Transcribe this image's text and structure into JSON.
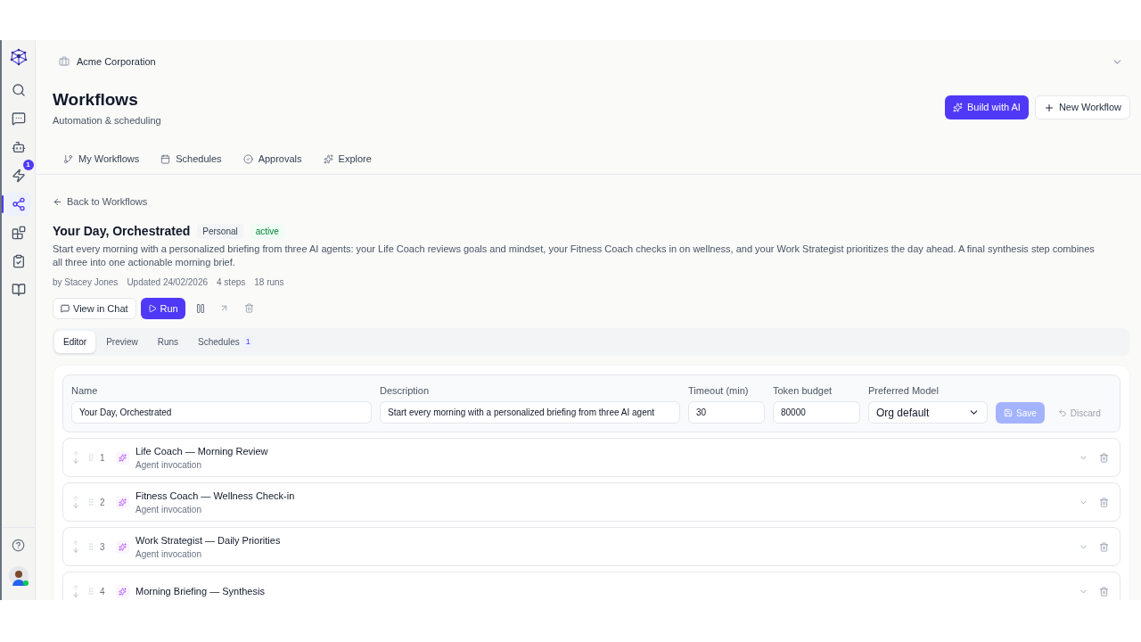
{
  "sidebar": {
    "items": [
      {
        "selected": false
      },
      {
        "selected": false
      },
      {
        "selected": false
      },
      {
        "selected": false,
        "badge": "1"
      },
      {
        "selected": true
      },
      {
        "selected": false
      },
      {
        "selected": false
      },
      {
        "selected": false
      }
    ]
  },
  "org": {
    "name": "Acme Corporation"
  },
  "header": {
    "title": "Workflows",
    "subtitle": "Automation & scheduling",
    "buttons": [
      {
        "label": "Build with AI",
        "kind": "primary"
      },
      {
        "label": "New Workflow",
        "kind": "secondary"
      }
    ]
  },
  "nav_tabs": [
    {
      "label": "My Workflows",
      "selected": false
    },
    {
      "label": "Schedules",
      "selected": false
    },
    {
      "label": "Approvals",
      "selected": false
    },
    {
      "label": "Explore",
      "selected": false
    }
  ],
  "back_link": "Back to Workflows",
  "workflow": {
    "title": "Your Day, Orchestrated",
    "tags": [
      {
        "label": "Personal",
        "kind": "scope"
      },
      {
        "label": "active",
        "kind": "status"
      }
    ],
    "description": "Start every morning with a personalized briefing from three AI agents: your Life Coach reviews goals and mindset, your Fitness Coach checks in on wellness, and your Work Strategist prioritizes the day ahead. A final synthesis step combines all three into one actionable morning brief.",
    "meta": [
      "by Stacey Jones",
      "Updated 24/02/2026",
      "4 steps",
      "18 runs"
    ],
    "actions": [
      {
        "label": "View in Chat",
        "kind": "secondary"
      },
      {
        "label": "Run",
        "kind": "primary"
      }
    ]
  },
  "editor_tabs": [
    {
      "label": "Editor",
      "selected": true
    },
    {
      "label": "Preview",
      "selected": false
    },
    {
      "label": "Runs",
      "selected": false
    },
    {
      "label": "Schedules",
      "selected": false,
      "count": "1"
    }
  ],
  "form": {
    "name": {
      "label": "Name",
      "value": "Your Day, Orchestrated"
    },
    "description": {
      "label": "Description",
      "value": "Start every morning with a personalized briefing from three AI agent"
    },
    "timeout": {
      "label": "Timeout (min)",
      "value": "30"
    },
    "token_budget": {
      "label": "Token budget",
      "value": "80000"
    },
    "model": {
      "label": "Preferred Model",
      "value": "Org default"
    },
    "save": {
      "label": "Save",
      "disabled": true
    },
    "discard": {
      "label": "Discard",
      "disabled": true
    }
  },
  "steps": [
    {
      "number": "1",
      "title": "Life Coach — Morning Review",
      "subtitle": "Agent invocation"
    },
    {
      "number": "2",
      "title": "Fitness Coach — Wellness Check-in",
      "subtitle": "Agent invocation"
    },
    {
      "number": "3",
      "title": "Work Strategist — Daily Priorities",
      "subtitle": "Agent invocation"
    },
    {
      "number": "4",
      "title": "Morning Briefing — Synthesis"
    }
  ]
}
